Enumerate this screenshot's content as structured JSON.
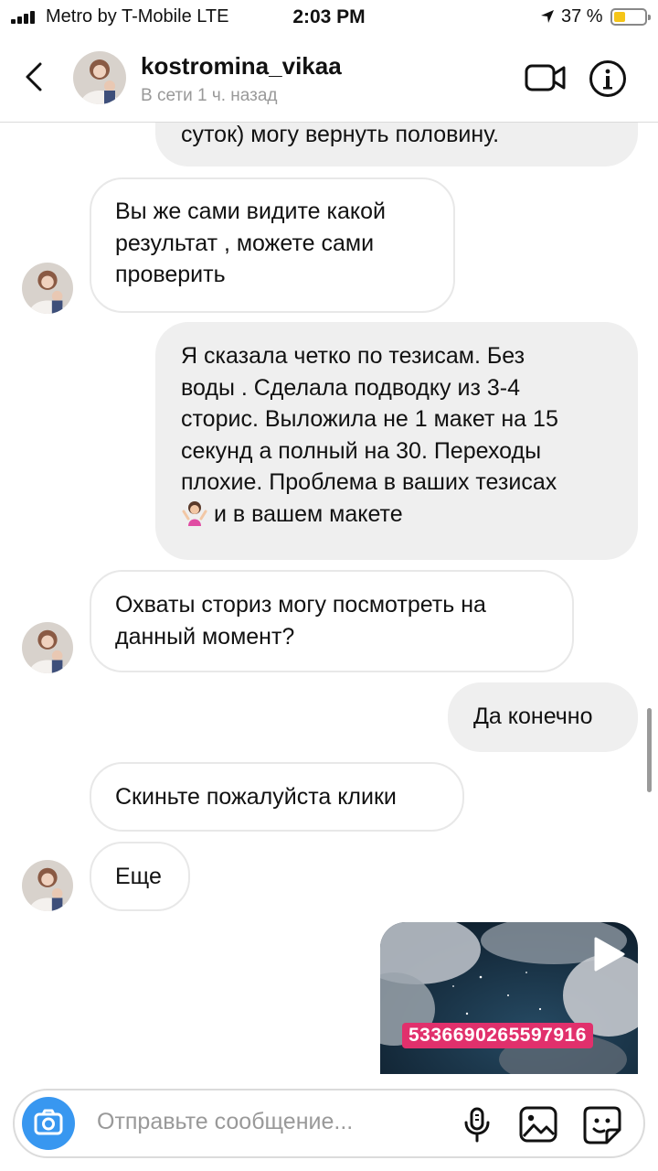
{
  "status_bar": {
    "carrier": "Metro by T-Mobile  LTE",
    "time": "2:03 PM",
    "battery_percent": "37 %",
    "battery_level": 0.37,
    "signal_icon": "cellular-signal-icon",
    "location_icon": "location-arrow-icon",
    "battery_color": "#f5c518"
  },
  "header": {
    "username": "kostromina_vikaa",
    "last_seen": "В сети 1 ч. назад",
    "icons": [
      "back-chevron-icon",
      "video-camera-icon",
      "info-icon"
    ]
  },
  "messages": [
    {
      "direction": "outgoing",
      "text": "суток) могу вернуть половину."
    },
    {
      "direction": "incoming",
      "lines": [
        "Вы же сами видите какой",
        "результат  , можете сами",
        "проверить"
      ]
    },
    {
      "direction": "outgoing",
      "lines": [
        "Я сказала четко по тезисам. Без",
        "воды . Сделала подводку из 3-4",
        "сторис. Выложила не 1 макет на 15",
        "секунд а полный на 30. Переходы",
        "плохие. Проблема в ваших тезисах"
      ],
      "last_line": "и в вашем макете",
      "emoji": "woman-shrugging-emoji"
    },
    {
      "direction": "incoming",
      "lines": [
        "Охваты сториз могу посмотреть на",
        "данный момент?"
      ]
    },
    {
      "direction": "outgoing",
      "text": "Да конечно"
    },
    {
      "direction": "incoming",
      "text": "Скиньте пожалуйста клики"
    },
    {
      "direction": "incoming",
      "text": "Еще"
    },
    {
      "direction": "outgoing",
      "type": "video",
      "overlay_code": "5336690265597916"
    }
  ],
  "composer": {
    "placeholder": "Отправьте сообщение...",
    "icons": [
      "camera-icon",
      "microphone-icon",
      "gallery-icon",
      "sticker-icon"
    ]
  },
  "colors": {
    "accent_blue": "#3897f0",
    "outgoing_bubble": "#efefef",
    "incoming_border": "#e8e8e8",
    "code_label": "#e1306c"
  }
}
